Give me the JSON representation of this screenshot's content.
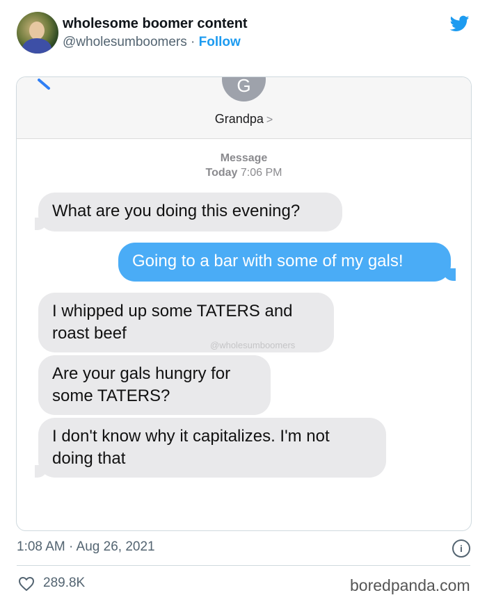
{
  "tweet": {
    "display_name": "wholesome boomer content",
    "handle": "@wholesumboomers",
    "separator": "·",
    "follow_label": "Follow",
    "timestamp": "1:08 AM · Aug 26, 2021",
    "like_count": "289.8K",
    "info_label": "i",
    "brand_color": "#1d9bf0"
  },
  "message_screenshot": {
    "contact_initial": "G",
    "contact_name": "Grandpa",
    "contact_chevron": ">",
    "meta_title": "Message",
    "meta_day": "Today",
    "meta_time": "7:06 PM",
    "messages": [
      {
        "direction": "incoming",
        "text": "What are you doing this evening?"
      },
      {
        "direction": "outgoing",
        "text": "Going to a bar with some of my gals!"
      },
      {
        "direction": "incoming",
        "text": "I whipped up some TATERS and roast beef"
      },
      {
        "direction": "incoming",
        "text": "Are your gals hungry for some TATERS?"
      },
      {
        "direction": "incoming",
        "text": "I don't know why it capitalizes. I'm not doing that"
      }
    ],
    "watermark": "@wholesumboomers",
    "incoming_color": "#e9e9eb",
    "outgoing_color": "#4aacf6"
  },
  "footer": {
    "brand": "boredpanda.com"
  },
  "icons": {
    "twitter": "twitter-bird-icon",
    "back": "chevron-left-icon",
    "info": "info-icon",
    "like": "heart-icon"
  }
}
